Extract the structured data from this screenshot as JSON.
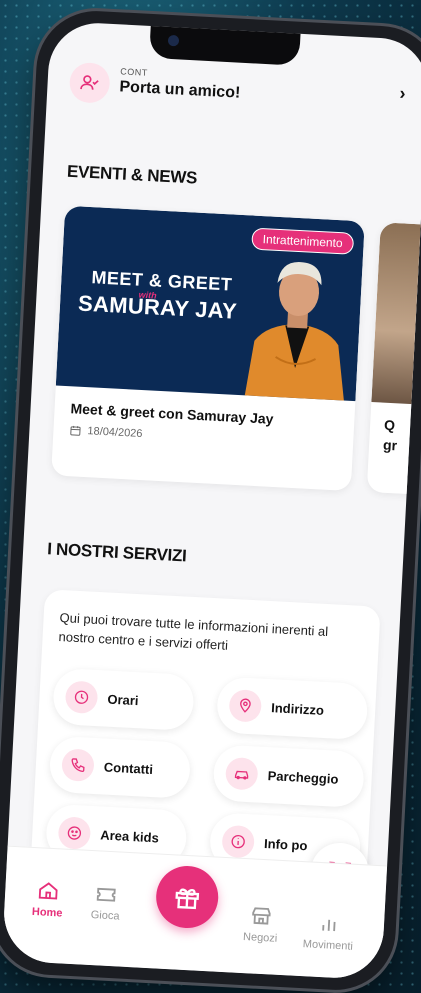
{
  "top_banner": {
    "small_label": "CONT",
    "title": "Porta un amico!",
    "chevron": "›"
  },
  "events_section": {
    "title": "EVENTI & NEWS",
    "cards": [
      {
        "tag": "Intrattenimento",
        "banner_line1": "MEET & GREET",
        "banner_with": "with",
        "banner_line2": "SAMURAY JAY",
        "title": "Meet & greet con Samuray Jay",
        "date": "18/04/2026"
      },
      {
        "title_partial": "Q\ngr"
      }
    ]
  },
  "services_section": {
    "title": "I NOSTRI SERVIZI",
    "description": "Qui puoi trovare tutte le informazioni inerenti al nostro centro e i servizi offerti",
    "items": [
      {
        "label": "Orari",
        "icon": "clock-icon"
      },
      {
        "label": "Indirizzo",
        "icon": "location-pin-icon"
      },
      {
        "label": "Contatti",
        "icon": "phone-icon"
      },
      {
        "label": "Parcheggio",
        "icon": "car-icon"
      },
      {
        "label": "Area kids",
        "icon": "kids-icon"
      },
      {
        "label": "Info po",
        "icon": "info-icon"
      }
    ]
  },
  "bottom_nav": {
    "items": [
      {
        "label": "Home",
        "icon": "home-icon",
        "active": true
      },
      {
        "label": "Gioca",
        "icon": "ticket-icon",
        "active": false
      },
      {
        "label": "",
        "icon": "gift-icon",
        "active": false
      },
      {
        "label": "Negozi",
        "icon": "store-icon",
        "active": false
      },
      {
        "label": "Movimenti",
        "icon": "bar-chart-icon",
        "active": false
      }
    ]
  },
  "colors": {
    "accent": "#e6307a",
    "accent_light": "#fde3ec",
    "banner_bg": "#0b2a55"
  }
}
